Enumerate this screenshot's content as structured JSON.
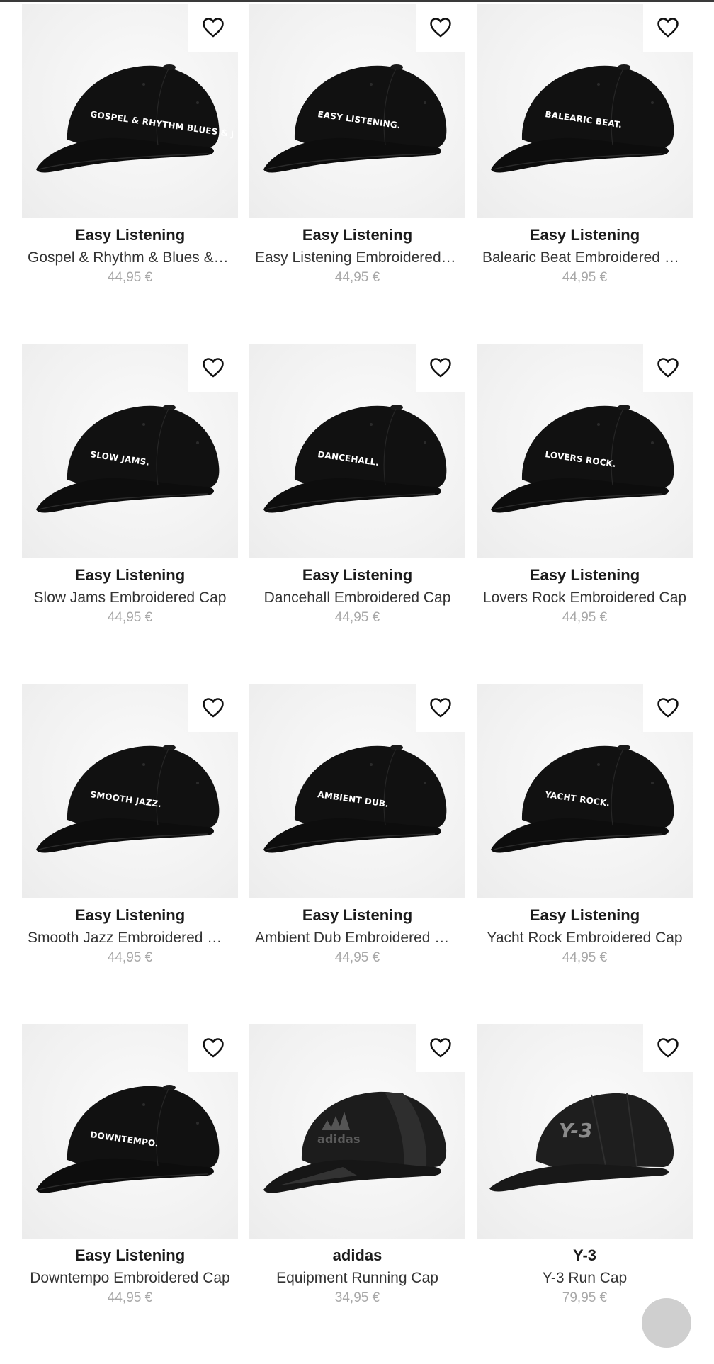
{
  "products": [
    {
      "brand": "Easy Listening",
      "name": "Gospel & Rhythm & Blues & J…",
      "price": "44,95 €",
      "cap_text": "GOSPEL & RHYTHM BLUES & JAZZ.",
      "cap_style": "dad"
    },
    {
      "brand": "Easy Listening",
      "name": "Easy Listening Embroidered …",
      "price": "44,95 €",
      "cap_text": "EASY LISTENING.",
      "cap_style": "dad"
    },
    {
      "brand": "Easy Listening",
      "name": "Balearic Beat Embroidered C…",
      "price": "44,95 €",
      "cap_text": "BALEARIC BEAT.",
      "cap_style": "dad"
    },
    {
      "brand": "Easy Listening",
      "name": "Slow Jams Embroidered Cap",
      "price": "44,95 €",
      "cap_text": "SLOW JAMS.",
      "cap_style": "dad"
    },
    {
      "brand": "Easy Listening",
      "name": "Dancehall Embroidered Cap",
      "price": "44,95 €",
      "cap_text": "DANCEHALL.",
      "cap_style": "dad"
    },
    {
      "brand": "Easy Listening",
      "name": "Lovers Rock Embroidered Cap",
      "price": "44,95 €",
      "cap_text": "LOVERS ROCK.",
      "cap_style": "dad"
    },
    {
      "brand": "Easy Listening",
      "name": "Smooth Jazz Embroidered Cap",
      "price": "44,95 €",
      "cap_text": "SMOOTH JAZZ.",
      "cap_style": "dad"
    },
    {
      "brand": "Easy Listening",
      "name": "Ambient Dub Embroidered Cap",
      "price": "44,95 €",
      "cap_text": "AMBIENT DUB.",
      "cap_style": "dad"
    },
    {
      "brand": "Easy Listening",
      "name": "Yacht Rock Embroidered Cap",
      "price": "44,95 €",
      "cap_text": "YACHT ROCK.",
      "cap_style": "dad"
    },
    {
      "brand": "Easy Listening",
      "name": "Downtempo Embroidered Cap",
      "price": "44,95 €",
      "cap_text": "DOWNTEMPO.",
      "cap_style": "dad"
    },
    {
      "brand": "adidas",
      "name": "Equipment Running Cap",
      "price": "34,95 €",
      "cap_text": "adidas",
      "cap_style": "running"
    },
    {
      "brand": "Y-3",
      "name": "Y-3 Run Cap",
      "price": "79,95 €",
      "cap_text": "Y-3",
      "cap_style": "y3"
    }
  ],
  "icons": {
    "favorite": "heart-outline-icon",
    "scroll_top": "scroll-to-top-button"
  },
  "colors": {
    "image_bg": "#f1f1f1",
    "price": "#a8a8a8",
    "brand": "#1b1b1b"
  }
}
